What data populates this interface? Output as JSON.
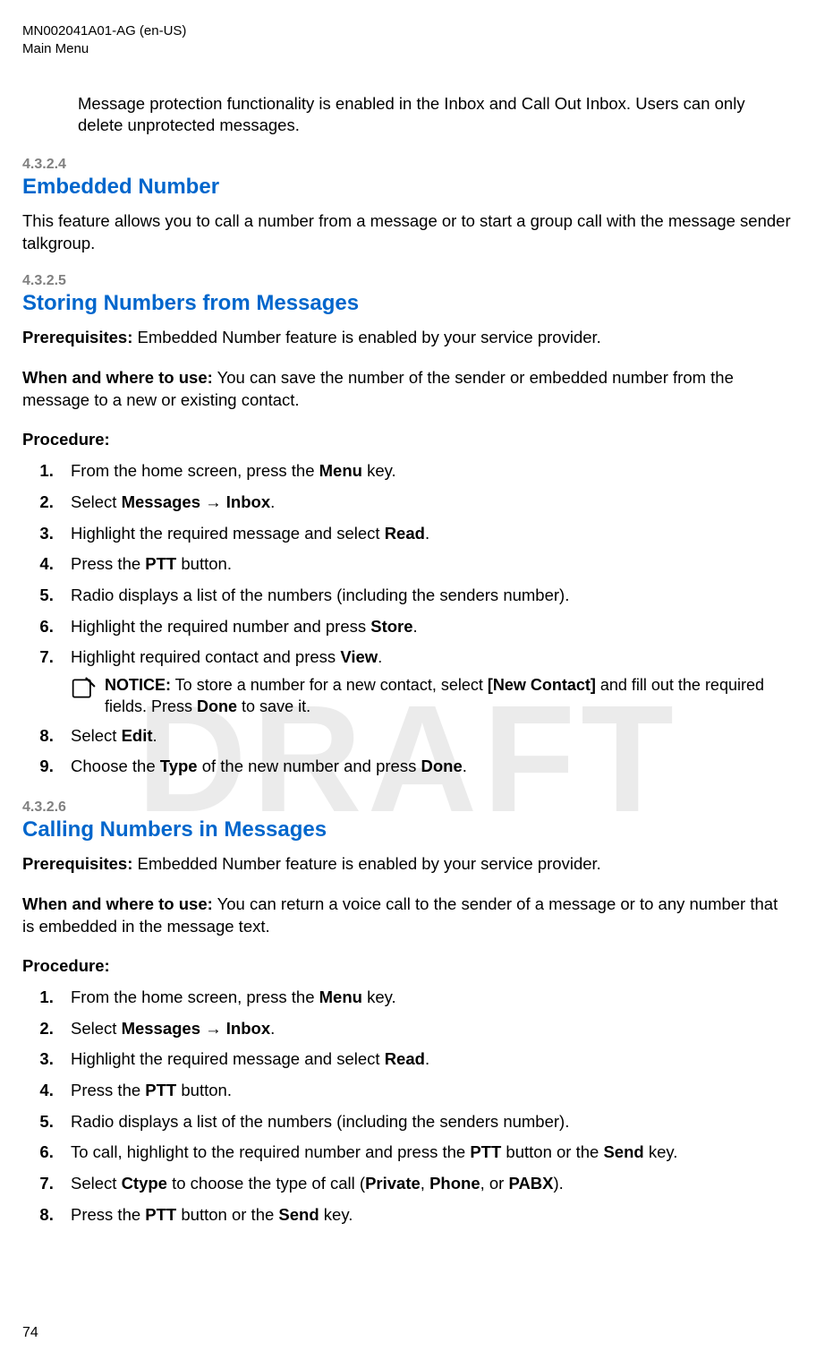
{
  "header": {
    "doc_id": "MN002041A01-AG (en-US)",
    "section": "Main Menu"
  },
  "watermark": "DRAFT",
  "intro_paragraph": "Message protection functionality is enabled in the Inbox and Call Out Inbox. Users can only delete unprotected messages.",
  "s4": {
    "num": "4.3.2.4",
    "title": "Embedded Number",
    "body": "This feature allows you to call a number from a message or to start a group call with the message sender talkgroup."
  },
  "s5": {
    "num": "4.3.2.5",
    "title": "Storing Numbers from Messages",
    "prereq_label": "Prerequisites:",
    "prereq_text": " Embedded Number feature is enabled by your service provider.",
    "when_label": "When and where to use:",
    "when_text": " You can save the number of the sender or embedded number from the message to a new or existing contact.",
    "proc_label": "Procedure:",
    "steps": {
      "s1a": "From the home screen, press the ",
      "s1b": "Menu",
      "s1c": " key.",
      "s2a": "Select ",
      "s2b": "Messages",
      "s2arrow": " → ",
      "s2c": "Inbox",
      "s2d": ".",
      "s3a": "Highlight the required message and select ",
      "s3b": "Read",
      "s3c": ".",
      "s4a": "Press the ",
      "s4b": "PTT",
      "s4c": " button.",
      "s5": "Radio displays a list of the numbers (including the senders number).",
      "s6a": "Highlight the required number and press ",
      "s6b": "Store",
      "s6c": ".",
      "s7a": "Highlight required contact and press ",
      "s7b": "View",
      "s7c": ".",
      "notice_label": "NOTICE:",
      "notice_a": " To store a number for a new contact, select ",
      "notice_b": "[New Contact]",
      "notice_c": " and fill out the required fields. Press ",
      "notice_d": "Done",
      "notice_e": " to save it.",
      "s8a": "Select ",
      "s8b": "Edit",
      "s8c": ".",
      "s9a": "Choose the ",
      "s9b": "Type",
      "s9c": " of the new number and press ",
      "s9d": "Done",
      "s9e": "."
    }
  },
  "s6": {
    "num": "4.3.2.6",
    "title": "Calling Numbers in Messages",
    "prereq_label": "Prerequisites:",
    "prereq_text": " Embedded Number feature is enabled by your service provider.",
    "when_label": "When and where to use:",
    "when_text": " You can return a voice call to the sender of a message or to any number that is embedded in the message text.",
    "proc_label": "Procedure:",
    "steps": {
      "s1a": "From the home screen, press the ",
      "s1b": "Menu",
      "s1c": " key.",
      "s2a": "Select ",
      "s2b": "Messages",
      "s2arrow": " → ",
      "s2c": "Inbox",
      "s2d": ".",
      "s3a": "Highlight the required message and select ",
      "s3b": "Read",
      "s3c": ".",
      "s4a": "Press the ",
      "s4b": "PTT",
      "s4c": " button.",
      "s5": "Radio displays a list of the numbers (including the senders number).",
      "s6a": "To call, highlight to the required number and press the ",
      "s6b": "PTT",
      "s6c": " button or the ",
      "s6d": "Send",
      "s6e": " key.",
      "s7a": "Select ",
      "s7b": "Ctype",
      "s7c": " to choose the type of call (",
      "s7d": "Private",
      "s7e": ", ",
      "s7f": "Phone",
      "s7g": ", or ",
      "s7h": "PABX",
      "s7i": ").",
      "s8a": "Press the ",
      "s8b": "PTT",
      "s8c": " button or the ",
      "s8d": "Send",
      "s8e": " key."
    }
  },
  "page_number": "74"
}
